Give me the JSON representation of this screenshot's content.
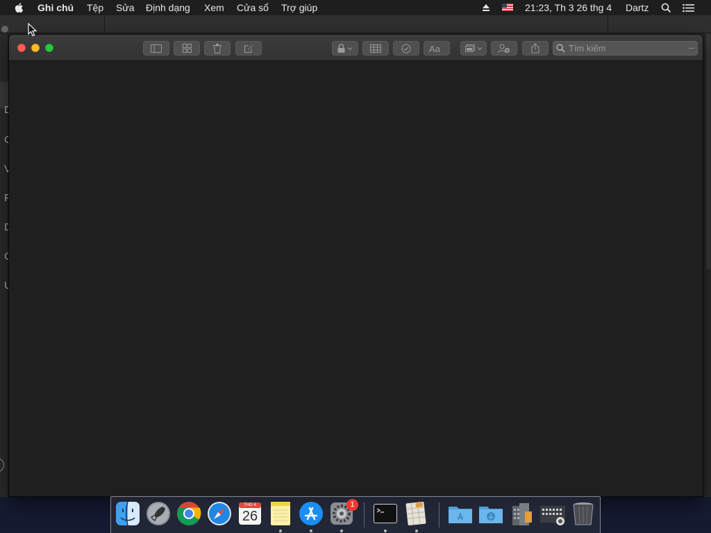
{
  "menubar": {
    "app_name": "Ghi chú",
    "items": [
      "Tệp",
      "Sửa",
      "Định dạng",
      "Xem",
      "Cửa sổ",
      "Trợ giúp"
    ],
    "clock": "21:23, Th 3 26 thg 4",
    "user": "Dartz",
    "icons": [
      "apple-logo",
      "eject-icon",
      "us-flag-icon",
      "spotlight-search-icon",
      "notification-center-icon"
    ]
  },
  "window": {
    "app": "Notes",
    "toolbar": {
      "buttons": [
        "sidebar-toggle",
        "attachments-browser",
        "delete-note",
        "new-note",
        "lock-note",
        "table",
        "checklist",
        "format-text",
        "media",
        "add-people",
        "share"
      ],
      "search_placeholder": "Tìm kiếm"
    }
  },
  "background_window": {
    "visible_initials": [
      "D",
      "C",
      "V",
      "F",
      "D",
      "C",
      "U"
    ]
  },
  "dock": {
    "calendar": {
      "month": "THG 4",
      "day": "26"
    },
    "system_preferences_badge": "1",
    "apps": [
      "Finder",
      "Launchpad",
      "Google Chrome",
      "Safari",
      "Calendar",
      "Notes",
      "App Store",
      "System Preferences",
      "Terminal",
      "Numbers",
      "Applications",
      "Downloads",
      "Documents",
      "Screenshots",
      "Trash"
    ]
  },
  "colors": {
    "menubar_bg": "#1e1e1e",
    "window_bg": "#1f1f1f",
    "titlebar_bg": "#363636",
    "close": "#fc5f57",
    "minimize": "#fdbc2e",
    "maximize": "#28c840",
    "badge": "#f03a2e"
  }
}
